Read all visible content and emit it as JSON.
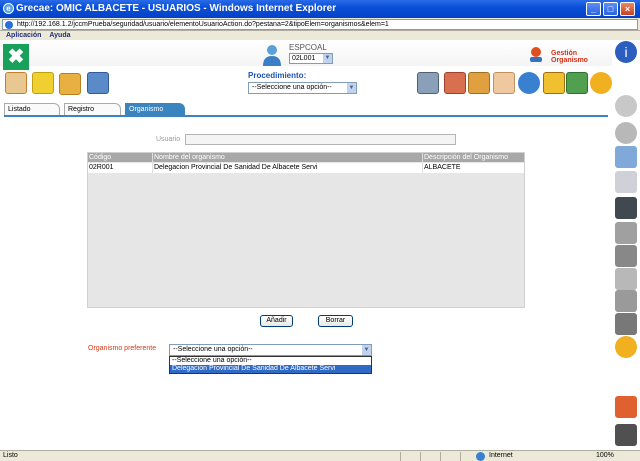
{
  "window": {
    "title": "Grecae: OMIC ALBACETE - USUARIOS - Windows Internet Explorer",
    "address": "http://192.168.1.2/jccmPrueba/seguridad/usuario/elementoUsuarioAction.do?pestana=2&tipoElem=organismos&elem=1"
  },
  "menu": [
    "Aplicación",
    "Ayuda"
  ],
  "header": {
    "user_code": "ESPCOAL",
    "user_select": "02L001",
    "app_name": "Gestión Organismo",
    "procedure_label": "Procedimiento:",
    "procedure_select": "--Seleccione una opción--"
  },
  "tabs": [
    "Listado",
    "Registro",
    "Organismo"
  ],
  "form": {
    "usuario_label": "Usuario",
    "usuario_value": ""
  },
  "table": {
    "headers": [
      "Código",
      "Nombre del organismo",
      "Descripción del Organismo"
    ],
    "rows": [
      [
        "02R001",
        "Delegacion Provincial De Sanidad De Albacete Servi",
        "ALBACETE"
      ]
    ]
  },
  "buttons": {
    "add": "Añadir",
    "delete": "Borrar"
  },
  "preferred": {
    "label": "Organismo preferente",
    "selected": "--Seleccione una opción--",
    "options": [
      "--Seleccione una opción--",
      "Delegacion Provincial De Sanidad De Albacete Servi"
    ]
  },
  "status": {
    "left": "Listo",
    "zone": "Internet",
    "zoom": "100%"
  },
  "colors": {
    "accent": "#3a85c0",
    "titlebar": "#0a4fd8",
    "brand": "#19a05a",
    "required": "#d23a1c"
  }
}
